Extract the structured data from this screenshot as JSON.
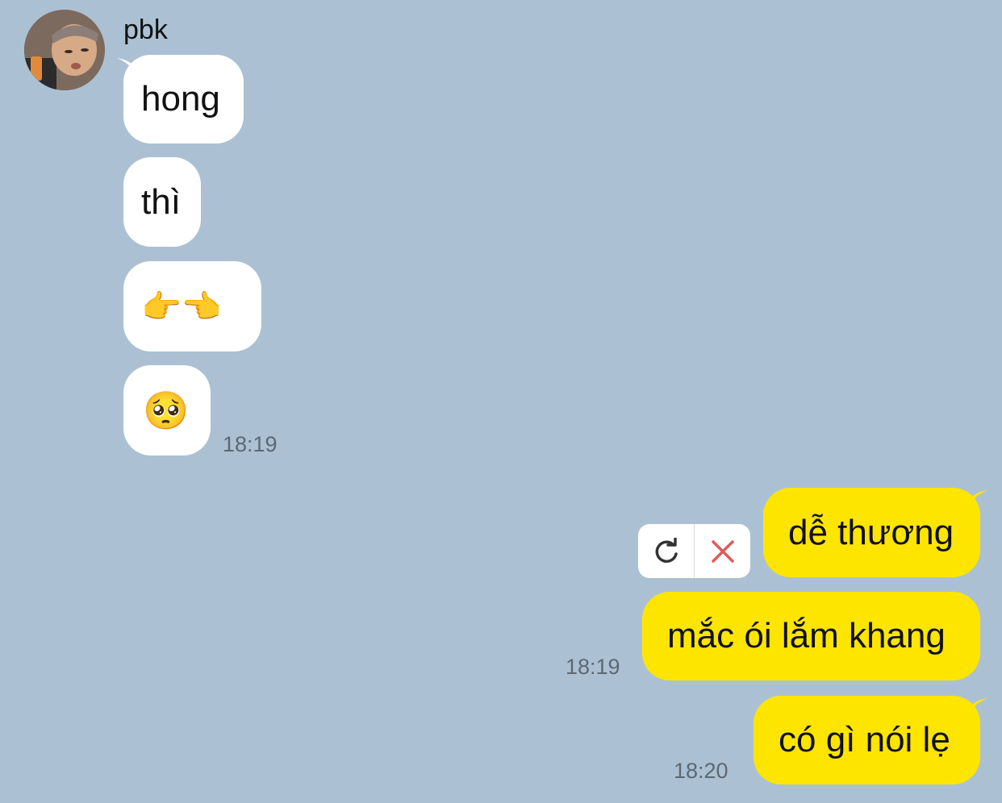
{
  "chat": {
    "sender_name": "pbk",
    "incoming": [
      {
        "text": "hong"
      },
      {
        "text": "thì"
      },
      {
        "text": "👉👈"
      },
      {
        "text": "🥺"
      }
    ],
    "incoming_time": "18:19",
    "outgoing": [
      {
        "text": "dễ thương"
      },
      {
        "text": "mắc ói lắm khang"
      },
      {
        "text": "có gì nói lẹ"
      }
    ],
    "outgoing_time_1": "18:19",
    "outgoing_time_2": "18:20"
  },
  "colors": {
    "background": "#abc1d3",
    "incoming_bubble": "#ffffff",
    "outgoing_bubble": "#fee500",
    "retry_icon": "#333333",
    "delete_icon": "#e05a5a"
  },
  "icons": {
    "retry": "retry-icon",
    "delete": "close-icon"
  }
}
